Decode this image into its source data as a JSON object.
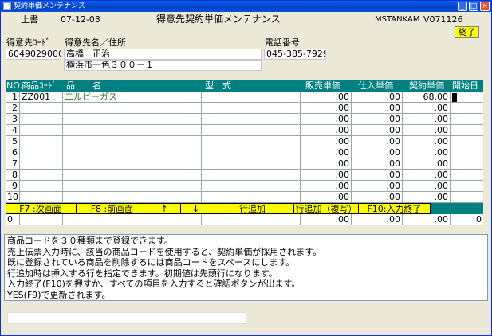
{
  "window": {
    "title": "契約単価メンテナンス",
    "min": "_",
    "max": "□",
    "close": "×"
  },
  "header": {
    "mode": "上書",
    "date": "07-12-03",
    "screen_title": "得意先契約単価メンテナンス",
    "program_id": "MSTANKAM",
    "version": "V071126",
    "end_button": "終了"
  },
  "customer": {
    "code_label": "得意先ｺｰﾄﾞ",
    "code": "6049029000",
    "name_label": "得意先名／住所",
    "name": "高橋　正治",
    "address": "横浜市一色３００－１",
    "phone_label": "電話番号",
    "phone": "045-385-7929"
  },
  "columns": {
    "no": "NO.",
    "code": "商品ｺｰﾄﾞ",
    "name": "品　　名",
    "model": "型　式",
    "sale": "販売単価",
    "cost": "仕入単価",
    "contract": "契約単価",
    "start": "開始日"
  },
  "rows": [
    {
      "no": "1",
      "code": "ZZ001",
      "name": "エルピーガス",
      "sale": ".00",
      "cost": ".00",
      "contract": "68.00"
    },
    {
      "no": "2",
      "code": "",
      "name": "",
      "sale": ".00",
      "cost": ".00",
      "contract": ".00"
    },
    {
      "no": "3",
      "code": "",
      "name": "",
      "sale": ".00",
      "cost": ".00",
      "contract": ".00"
    },
    {
      "no": "4",
      "code": "",
      "name": "",
      "sale": ".00",
      "cost": ".00",
      "contract": ".00"
    },
    {
      "no": "5",
      "code": "",
      "name": "",
      "sale": ".00",
      "cost": ".00",
      "contract": ".00"
    },
    {
      "no": "6",
      "code": "",
      "name": "",
      "sale": ".00",
      "cost": ".00",
      "contract": ".00"
    },
    {
      "no": "7",
      "code": "",
      "name": "",
      "sale": ".00",
      "cost": ".00",
      "contract": ".00"
    },
    {
      "no": "8",
      "code": "",
      "name": "",
      "sale": ".00",
      "cost": ".00",
      "contract": ".00"
    },
    {
      "no": "9",
      "code": "",
      "name": "",
      "sale": ".00",
      "cost": ".00",
      "contract": ".00"
    },
    {
      "no": "10",
      "code": "",
      "name": "",
      "sale": ".00",
      "cost": ".00",
      "contract": ".00"
    }
  ],
  "function_keys": {
    "f7": "F7 :次画面",
    "f8": "F8 :前画面",
    "up": "↑",
    "down": "↓",
    "add": "行追加",
    "add_copy": "行追加（複写）",
    "f10": "F10:入力終了"
  },
  "input_row": {
    "no": "0",
    "sale": ".00",
    "cost": ".00",
    "contract": ".00",
    "start": "0"
  },
  "messages": [
    "商品コードを３０種類まで登録できます。",
    "売上伝票入力時に、該当の商品コードを使用すると、契約単価が採用されます。",
    "既に登録されている商品を削除するには商品コードをスペースにします。",
    "行追加時は挿入する行を指定できます。初期値は先頭行になります。",
    "入力終了(F10)を押すか、すべての項目を入力すると確認ボタンが出ます。",
    "YES(F9)で更新されます。"
  ]
}
